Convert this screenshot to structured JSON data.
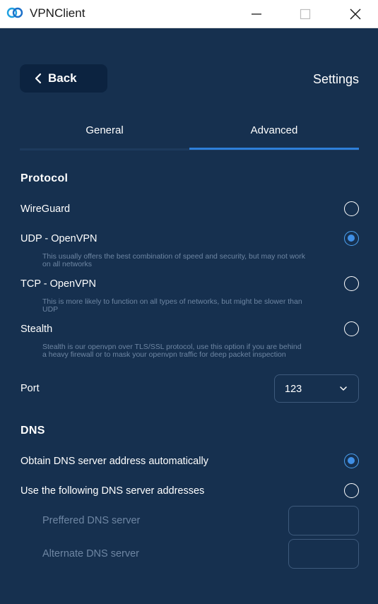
{
  "window": {
    "title": "VPNClient",
    "logo_icon": "vpn-rings-logo",
    "minimize_icon": "minimize-icon",
    "maximize_icon": "maximize-icon",
    "close_icon": "close-icon"
  },
  "header": {
    "back_label": "Back",
    "page_title": "Settings"
  },
  "tabs": [
    {
      "label": "General",
      "active": false
    },
    {
      "label": "Advanced",
      "active": true
    }
  ],
  "protocol": {
    "title": "Protocol",
    "options": [
      {
        "label": "WireGuard",
        "description": "",
        "selected": false
      },
      {
        "label": "UDP - OpenVPN",
        "description": "This usually offers the best combination of speed and security, but may not work on all networks",
        "selected": true
      },
      {
        "label": "TCP - OpenVPN",
        "description": "This is more likely to function on all types of networks, but might be slower than UDP",
        "selected": false
      },
      {
        "label": "Stealth",
        "description": "Stealth is our openvpn over TLS/SSL protocol, use this option if you are behind a heavy firewall or to mask your openvpn traffic for deep packet inspection",
        "selected": false
      }
    ],
    "port": {
      "label": "Port",
      "value": "123"
    }
  },
  "dns": {
    "title": "DNS",
    "options": [
      {
        "label": "Obtain DNS server address automatically",
        "selected": true
      },
      {
        "label": "Use the following DNS server addresses",
        "selected": false
      }
    ],
    "preferred_label": "Preffered DNS server",
    "preferred_value": "",
    "alternate_label": "Alternate DNS server",
    "alternate_value": ""
  },
  "colors": {
    "background": "#16304f",
    "accent": "#2e7fd9",
    "muted_text": "#6e86a3"
  }
}
